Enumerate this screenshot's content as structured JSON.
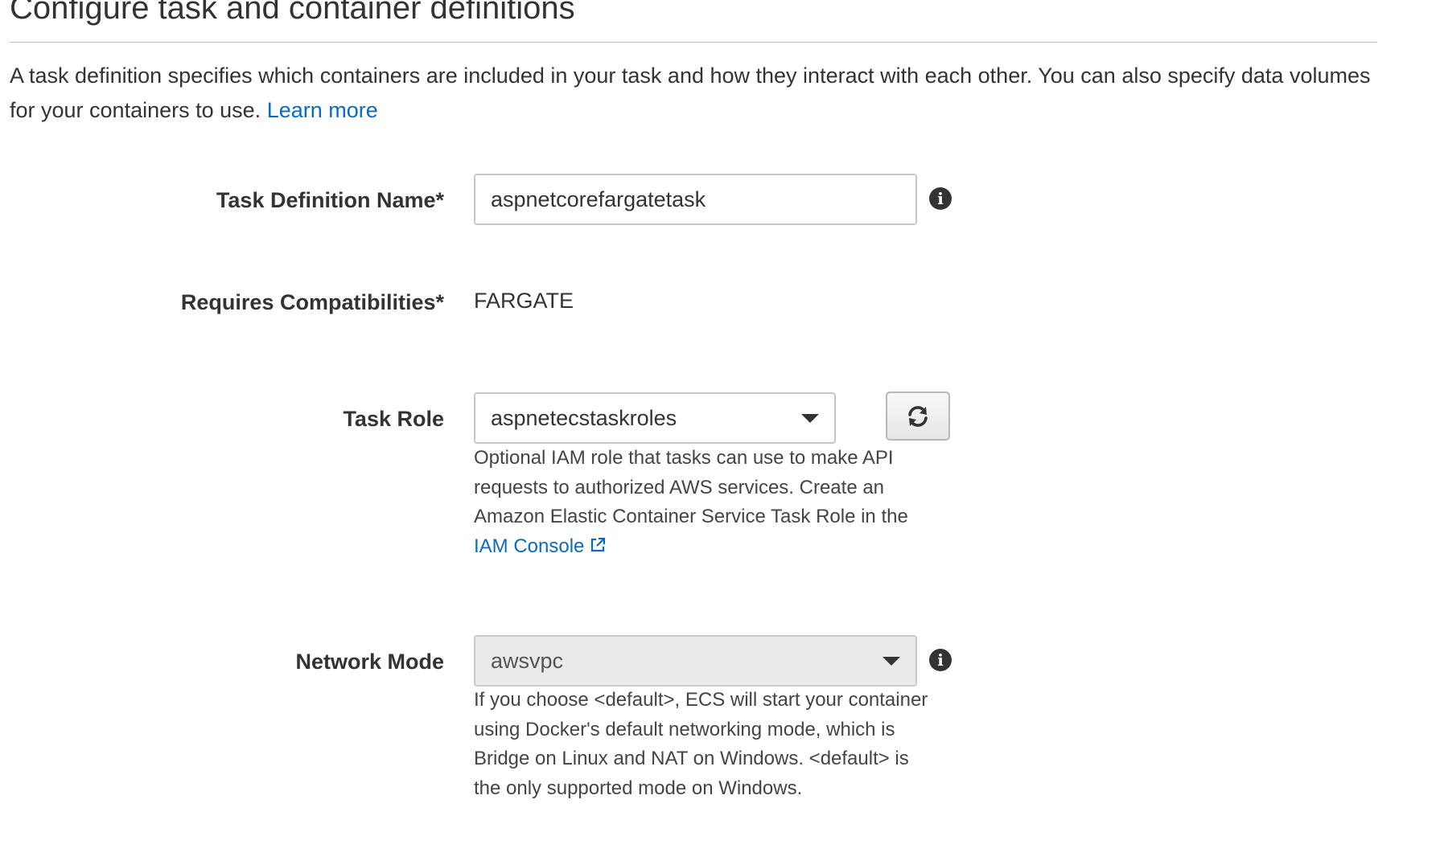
{
  "page": {
    "title": "Configure task and container definitions",
    "intro": "A task definition specifies which containers are included in your task and how they interact with each other. You can also specify data volumes for your containers to use.",
    "learn_more": "Learn more"
  },
  "fields": {
    "task_definition_name": {
      "label": "Task Definition Name*",
      "value": "aspnetcorefargatetask"
    },
    "requires_compatibilities": {
      "label": "Requires Compatibilities*",
      "value": "FARGATE"
    },
    "task_role": {
      "label": "Task Role",
      "selected": "aspnetecstaskroles",
      "help": "Optional IAM role that tasks can use to make API requests to authorized AWS services. Create an Amazon Elastic Container Service Task Role in the",
      "help_link": "IAM Console"
    },
    "network_mode": {
      "label": "Network Mode",
      "selected": "awsvpc",
      "help": "If you choose <default>, ECS will start your container using Docker's default networking mode, which is Bridge on Linux and NAT on Windows. <default> is the only supported mode on Windows."
    }
  },
  "icons": {
    "info": "info-icon",
    "refresh": "refresh-icon",
    "external_link": "external-link-icon",
    "dropdown": "chevron-down-icon"
  },
  "colors": {
    "link": "#0b6bbd",
    "text": "#333333",
    "border": "#c6c6c6",
    "disabled_bg": "#eaeaea"
  }
}
